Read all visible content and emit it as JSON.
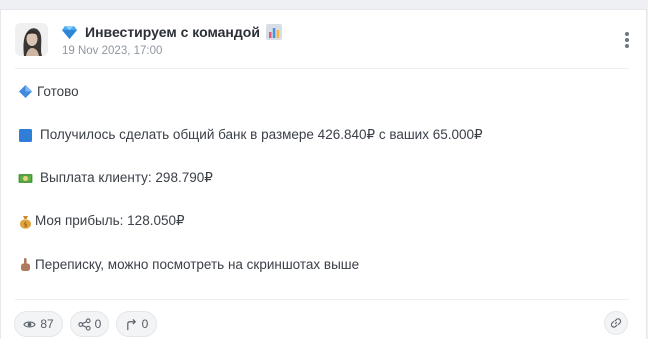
{
  "post": {
    "channel_title": "Инвестируем с командой",
    "date": "19 Nov 2023, 17:00",
    "lines": [
      {
        "icon": "blue-diamond-icon",
        "text": "Готово"
      },
      {
        "icon": "blue-square-icon",
        "text": "Получилось сделать общий банк в размере 426.840₽ с ваших 65.000₽"
      },
      {
        "icon": "money-banknote-icon",
        "text": "Выплата клиенту: 298.790₽"
      },
      {
        "icon": "money-bag-icon",
        "text": "Моя прибыль: 128.050₽"
      },
      {
        "icon": "pointing-hand-icon",
        "text": "Переписку, можно посмотреть на скриншотах выше"
      }
    ]
  },
  "footer": {
    "views": "87",
    "shares": "0",
    "forwards": "0"
  },
  "colors": {
    "accent_blue": "#3a7bd5",
    "text": "#3b4048",
    "muted": "#8f96a0"
  }
}
